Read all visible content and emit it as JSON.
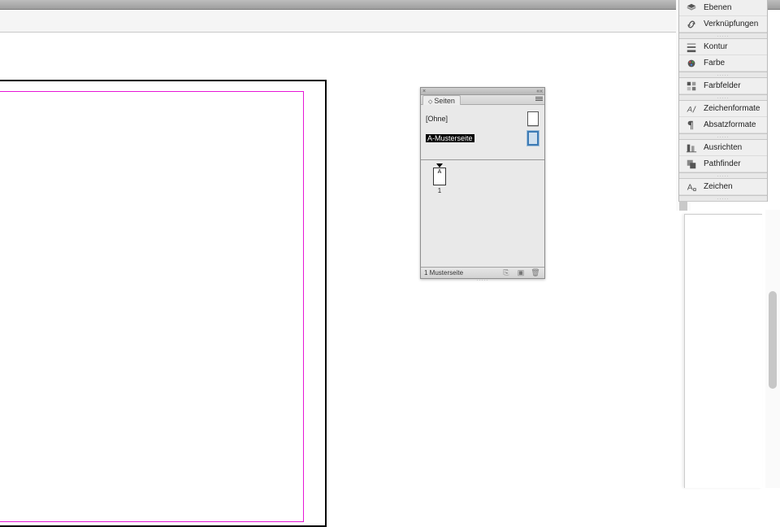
{
  "pagesPanel": {
    "title": "Seiten",
    "masters": [
      {
        "label": "[Ohne]",
        "selected": false
      },
      {
        "label": "A-Musterseite",
        "selected": true
      }
    ],
    "spread": {
      "letter": "A",
      "number": "1"
    },
    "status": "1 Musterseite"
  },
  "dock": {
    "items": [
      {
        "key": "ebenen",
        "label": "Ebenen",
        "icon": "layers-icon"
      },
      {
        "key": "verknuepfungen",
        "label": "Verknüpfungen",
        "icon": "links-icon"
      }
    ],
    "items2": [
      {
        "key": "kontur",
        "label": "Kontur",
        "icon": "stroke-icon"
      },
      {
        "key": "farbe",
        "label": "Farbe",
        "icon": "color-icon"
      }
    ],
    "items3": [
      {
        "key": "farbfelder",
        "label": "Farbfelder",
        "icon": "swatches-icon"
      }
    ],
    "items4": [
      {
        "key": "zeichenformate",
        "label": "Zeichenformate",
        "icon": "charstyle-icon"
      },
      {
        "key": "absatzformate",
        "label": "Absatzformate",
        "icon": "parastyle-icon"
      }
    ],
    "items5": [
      {
        "key": "ausrichten",
        "label": "Ausrichten",
        "icon": "align-icon"
      },
      {
        "key": "pathfinder",
        "label": "Pathfinder",
        "icon": "pathfinder-icon"
      }
    ],
    "items6": [
      {
        "key": "zeichen",
        "label": "Zeichen",
        "icon": "glyph-icon"
      }
    ]
  }
}
